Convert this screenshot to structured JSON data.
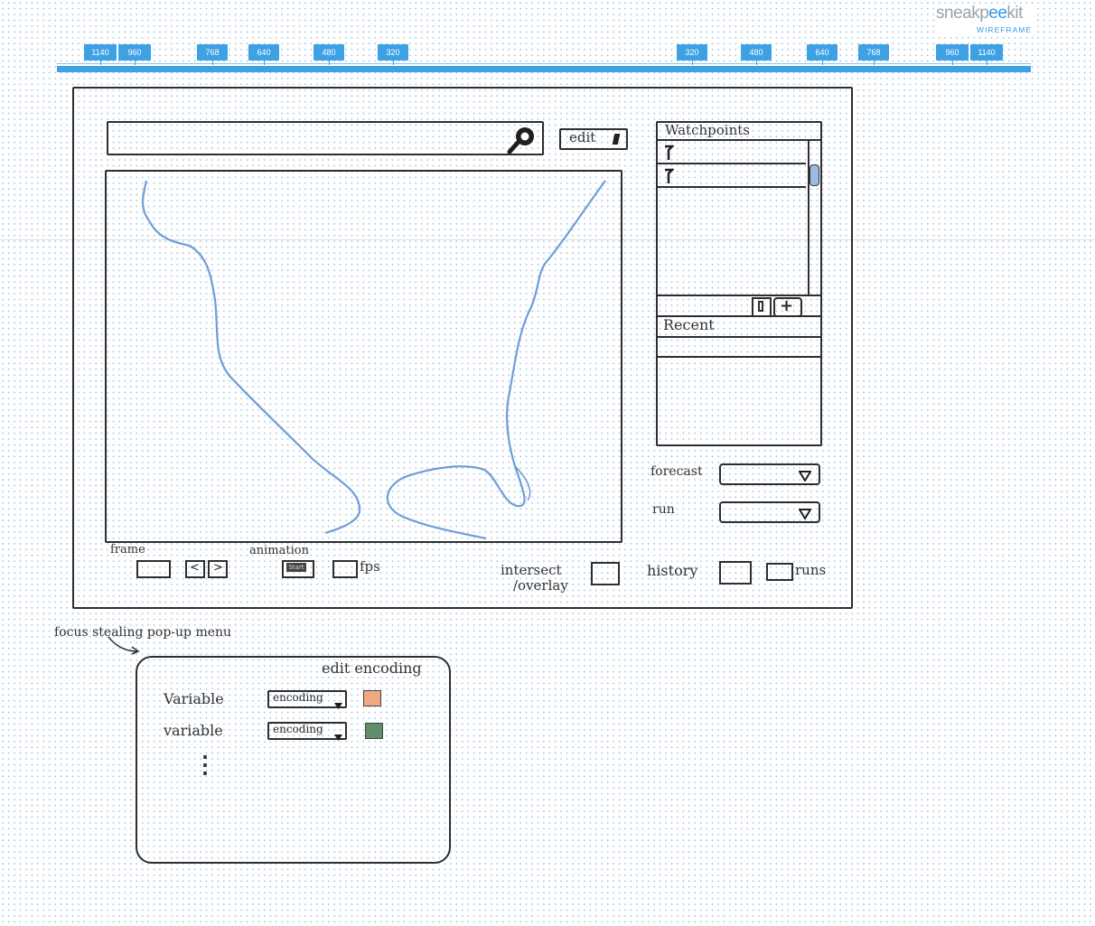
{
  "logo": {
    "brand_a": "sneakp",
    "brand_b": "ee",
    "brand_c": "kit",
    "sub": "WIREFRAME"
  },
  "ruler": {
    "left_tags": [
      "1140",
      "960",
      "768",
      "640",
      "480",
      "320"
    ],
    "right_tags": [
      "320",
      "480",
      "640",
      "768",
      "960",
      "1140"
    ]
  },
  "toolbar": {
    "edit_label": "edit"
  },
  "watchpoints": {
    "title": "Watchpoints",
    "items": [
      "",
      ""
    ],
    "recent_title": "Recent"
  },
  "controls": {
    "forecast_label": "forecast",
    "run_label": "run",
    "frame_label": "frame",
    "prev_label": "<",
    "next_label": ">",
    "animation_label": "animation",
    "start_label": "Start",
    "fps_label": "fps",
    "intersect_label_1": "intersect",
    "intersect_label_2": "/overlay",
    "history_label": "history",
    "runs_label": "runs"
  },
  "popup": {
    "annotation": "focus stealing pop-up menu",
    "title": "edit encoding",
    "rows": [
      {
        "variable": "Variable",
        "encoding": "encoding",
        "color": "#f0a882"
      },
      {
        "variable": "variable",
        "encoding": "encoding",
        "color": "#5e8f6a"
      }
    ],
    "ellipsis": "⋮"
  },
  "colors": {
    "ruler": "#3ea1e3",
    "map_outline": "#6e9ed8",
    "ink": "#2e2e2e"
  }
}
